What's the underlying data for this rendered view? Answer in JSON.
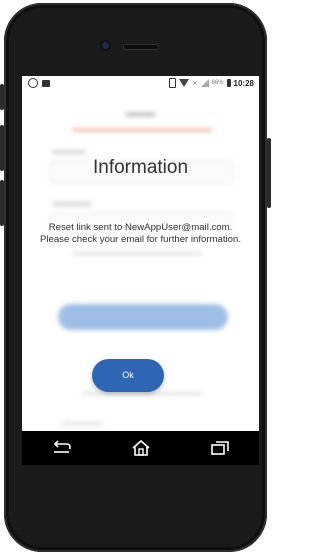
{
  "status_bar": {
    "left_icons": [
      "whatsapp-icon",
      "image-icon"
    ],
    "right_icons": [
      "vibrate-icon",
      "wifi-icon",
      "signal-icon",
      "battery-icon"
    ],
    "network_label": "✕",
    "battery_percent": "86%",
    "time": "10:28"
  },
  "dialog": {
    "title": "Information",
    "message": "Reset link sent to NewAppUser@mail.com. Please check your email for further information.",
    "ok_label": "Ok"
  },
  "navigation": {
    "back_icon": "back-icon",
    "home_icon": "home-icon",
    "recents_icon": "recents-icon"
  },
  "colors": {
    "accent": "#2f66b3",
    "phone_body": "#1b1b1b",
    "navbar": "#000000"
  }
}
